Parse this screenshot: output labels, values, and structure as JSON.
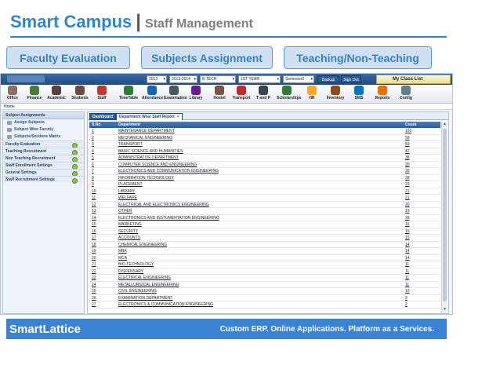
{
  "slide": {
    "title_main": "Smart Campus",
    "title_separator": "|",
    "title_sub": "Staff Management",
    "pills": [
      "Faculty Evaluation",
      "Subjects Assignment",
      "Teaching/Non-Teaching"
    ],
    "footer_brand": "SmartLattice",
    "footer_tagline": "Custom ERP. Online Applications. Platform as a Services."
  },
  "app": {
    "topbar": {
      "selects": [
        "2013",
        "2013-2014",
        "B.TECH",
        "1ST YEAR",
        "Semester2"
      ],
      "buttons": [
        "Backup App",
        "Sign Out"
      ],
      "myclass": "My Class List"
    },
    "icons": [
      {
        "label": "Office",
        "icon": "office-icon",
        "color": "#8d6e63"
      },
      {
        "label": "Finance",
        "icon": "finance-icon",
        "color": "#4a7c3a"
      },
      {
        "label": "Academic",
        "icon": "academic-icon",
        "color": "#5d4037"
      },
      {
        "label": "Students",
        "icon": "students-icon",
        "color": "#6d4c41"
      },
      {
        "label": "Staff",
        "icon": "staff-icon",
        "color": "#c0392b"
      },
      {
        "label": "TimeTable",
        "icon": "timetable-icon",
        "color": "#2e7d32"
      },
      {
        "label": "Attendance",
        "icon": "attendance-icon",
        "color": "#1565c0"
      },
      {
        "label": "Examination",
        "icon": "examination-icon",
        "color": "#455a64"
      },
      {
        "label": "Library",
        "icon": "library-icon",
        "color": "#6a1b9a"
      },
      {
        "label": "Hostel",
        "icon": "hostel-icon",
        "color": "#795548"
      },
      {
        "label": "Transport",
        "icon": "transport-icon",
        "color": "#c62828"
      },
      {
        "label": "T and P",
        "icon": "t-and-p-icon",
        "color": "#37474f"
      },
      {
        "label": "Scholarships",
        "icon": "scholarships-icon",
        "color": "#2e7d32"
      },
      {
        "label": "HR",
        "icon": "hr-icon",
        "color": "#f9a825"
      },
      {
        "label": "Inventory",
        "icon": "inventory-icon",
        "color": "#8e4a1f"
      },
      {
        "label": "SMS",
        "icon": "sms-icon",
        "color": "#0277bd"
      },
      {
        "label": "Reports",
        "icon": "reports-icon",
        "color": "#ef6c00"
      },
      {
        "label": "Config",
        "icon": "config-icon",
        "color": "#607d8b"
      }
    ],
    "home_label": "Home",
    "sidebar": {
      "header": "Subject Assignments",
      "subitems": [
        "Assign Subjects",
        "Subject Wise Faculty",
        "Subjects/Sections Matrix"
      ],
      "groups": [
        "Faculty Evaluation",
        "Teaching Recruitment",
        "Non Teaching Recruitment",
        "Staff Enrollment Settings",
        "General Settings",
        "Staff Recruitment Settings"
      ]
    },
    "tabs": [
      "Dashboard",
      "Department Wise Staff Report"
    ],
    "tab_close": "×",
    "table": {
      "headers": [
        "S.No",
        "Department",
        "Count"
      ],
      "rows": [
        [
          "1",
          "MAINTENANCE DEPARTMENT",
          "101"
        ],
        [
          "2",
          "MECHANICAL ENGINEERING",
          "59"
        ],
        [
          "3",
          "TRANSPORT",
          "59"
        ],
        [
          "4",
          "BASIC SCIENCE AND HUMANITIES",
          "42"
        ],
        [
          "5",
          "ADMINISTRATIVE DEPARTMENT",
          "38"
        ],
        [
          "6",
          "COMPUTER SCIENCE AND  ENGINEERING",
          "30"
        ],
        [
          "7",
          "ELECTRONICS AND COMMUNICATION ENGINEERING",
          "30"
        ],
        [
          "8",
          "INFORMATION TECHNOLOGY",
          "28"
        ],
        [
          "9",
          "PLACEMENT",
          "23"
        ],
        [
          "10",
          "LIBRARY",
          "21"
        ],
        [
          "11",
          "WELFARE",
          "21"
        ],
        [
          "12",
          "ELECTRICAL AND ELECTRONICS ENGINEERING",
          "20"
        ],
        [
          "13",
          "OTHER",
          "19"
        ],
        [
          "14",
          "ELECTRONICS AND INSTUMENTATION ENGINEERING",
          "18"
        ],
        [
          "15",
          "MARKETING",
          "16"
        ],
        [
          "16",
          "SECURITY",
          "15"
        ],
        [
          "17",
          "ACCOUNTS",
          "15"
        ],
        [
          "18",
          "CHEMICAL ENGINEERING",
          "14"
        ],
        [
          "19",
          "MBA",
          "14"
        ],
        [
          "20",
          "MCA",
          "14"
        ],
        [
          "21",
          "BIO-TECHNOLOGY",
          "11"
        ],
        [
          "22",
          "DISPENSARY",
          "11"
        ],
        [
          "23",
          "ELECTRICAL ENGINEERING",
          "11"
        ],
        [
          "24",
          "METALLURGICAL ENGINEERING",
          "11"
        ],
        [
          "25",
          "CIVIL ENGINEERING",
          "10"
        ],
        [
          "26",
          "EXAMINATION DEPARTMENT",
          "3"
        ],
        [
          "27",
          "ELECTRONICS & COMMUNICATION ENGINEERING",
          "2"
        ]
      ]
    }
  }
}
